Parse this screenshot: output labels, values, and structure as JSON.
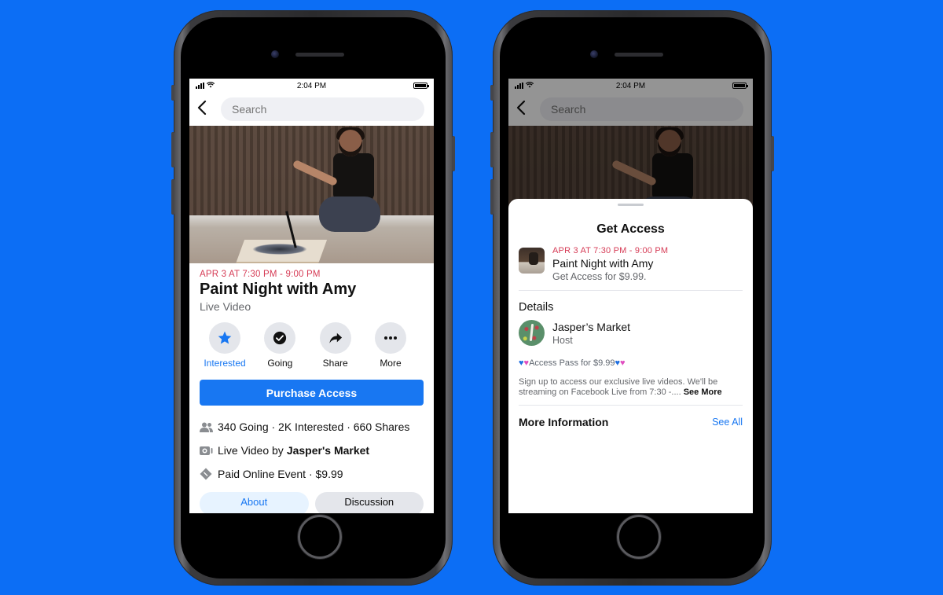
{
  "colors": {
    "background": "#0c6ef5",
    "accent": "#1877f2",
    "date_red": "#d63b55",
    "secondary_text": "#65676b"
  },
  "phones": [
    {
      "status": {
        "time": "2:04 PM",
        "wifi_icon": "wifi-icon",
        "battery_icon": "battery-icon"
      },
      "nav": {
        "back_icon": "chevron-left-icon",
        "search_placeholder": "Search"
      },
      "event": {
        "date": "APR 3 AT 7:30 PM - 9:00 PM",
        "title": "Paint Night with Amy",
        "type": "Live Video"
      },
      "actions": [
        {
          "label": "Interested",
          "icon": "star-icon",
          "active": true
        },
        {
          "label": "Going",
          "icon": "check-circle-icon",
          "active": false
        },
        {
          "label": "Share",
          "icon": "share-arrow-icon",
          "active": false
        },
        {
          "label": "More",
          "icon": "more-dots-icon",
          "active": false
        }
      ],
      "primary_button": "Purchase Access",
      "info": {
        "stats": "340 Going · 2K Interested · 660 Shares",
        "live_prefix": "Live Video by ",
        "live_host": "Jasper's Market",
        "paid": "Paid Online Event · $9.99"
      },
      "tabs": [
        {
          "label": "About"
        },
        {
          "label": "Discussion"
        }
      ]
    },
    {
      "status": {
        "time": "2:04 PM"
      },
      "nav": {
        "search_placeholder": "Search"
      },
      "sheet": {
        "title": "Get Access",
        "event_date": "APR 3 AT 7:30 PM - 9:00 PM",
        "event_name": "Paint Night with Amy",
        "event_price": "Get Access for $9.99.",
        "details_title": "Details",
        "host_name": "Jasper’s Market",
        "host_role": "Host",
        "pass_label": " Access Pass for $9.99",
        "description": "Sign up to access our exclusive live videos. We'll be streaming on Facebook Live from 7:30 -....",
        "see_more": "See More",
        "more_info_title": "More Information",
        "see_all": "See All"
      }
    }
  ]
}
